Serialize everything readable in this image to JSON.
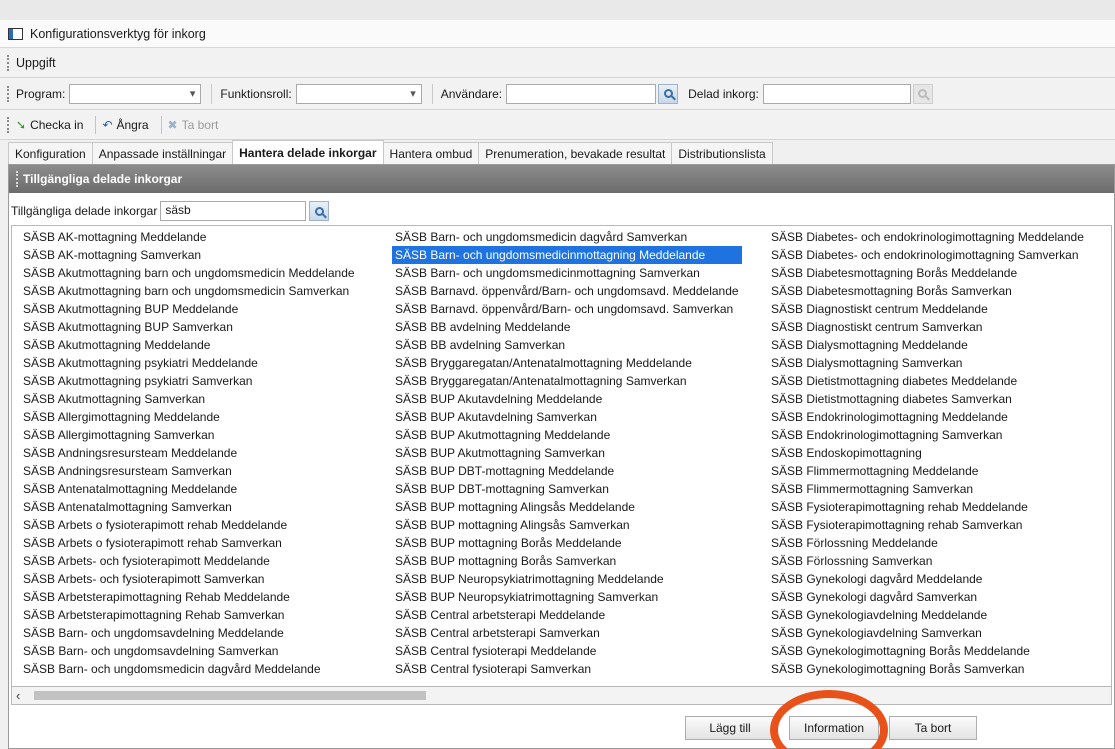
{
  "window": {
    "title": "Konfigurationsverktyg för inkorg"
  },
  "menu": {
    "item": "Uppgift"
  },
  "filters": {
    "program_label": "Program:",
    "funktionsroll_label": "Funktionsroll:",
    "anvandare_label": "Användare:",
    "delad_inkorg_label": "Delad inkorg:"
  },
  "toolbar": {
    "checkin_label": "Checka in",
    "undo_label": "Ångra",
    "remove_label": "Ta bort"
  },
  "tabs": [
    {
      "label": "Konfiguration"
    },
    {
      "label": "Anpassade inställningar"
    },
    {
      "label": "Hantera delade inkorgar",
      "active": true
    },
    {
      "label": "Hantera ombud"
    },
    {
      "label": "Prenumeration, bevakade resultat"
    },
    {
      "label": "Distributionslista"
    }
  ],
  "panel": {
    "header": "Tillgängliga delade inkorgar",
    "search_label": "Tillgängliga delade inkorgar",
    "search_value": "säsb"
  },
  "list": {
    "selected": "SÄSB Barn- och ungdomsmedicinmottagning Meddelande",
    "col1": [
      "SÄSB AK-mottagning Meddelande",
      "SÄSB AK-mottagning Samverkan",
      "SÄSB Akutmottagning barn och ungdomsmedicin Meddelande",
      "SÄSB Akutmottagning barn och ungdomsmedicin Samverkan",
      "SÄSB Akutmottagning BUP Meddelande",
      "SÄSB Akutmottagning BUP Samverkan",
      "SÄSB Akutmottagning Meddelande",
      "SÄSB Akutmottagning psykiatri Meddelande",
      "SÄSB Akutmottagning psykiatri Samverkan",
      "SÄSB Akutmottagning Samverkan",
      "SÄSB Allergimottagning Meddelande",
      "SÄSB Allergimottagning Samverkan",
      "SÄSB Andningsresursteam Meddelande",
      "SÄSB Andningsresursteam Samverkan",
      "SÄSB Antenatalmottagning Meddelande",
      "SÄSB Antenatalmottagning Samverkan",
      "SÄSB Arbets o fysioterapimott rehab Meddelande",
      "SÄSB Arbets o fysioterapimott rehab Samverkan",
      "SÄSB Arbets- och fysioterapimott Meddelande",
      "SÄSB Arbets- och fysioterapimott Samverkan",
      "SÄSB Arbetsterapimottagning Rehab Meddelande",
      "SÄSB Arbetsterapimottagning Rehab Samverkan",
      "SÄSB Barn- och ungdomsavdelning Meddelande",
      "SÄSB Barn- och ungdomsavdelning Samverkan",
      "SÄSB Barn- och ungdomsmedicin dagvård Meddelande"
    ],
    "col2": [
      "SÄSB Barn- och ungdomsmedicin dagvård Samverkan",
      "SÄSB Barn- och ungdomsmedicinmottagning Meddelande",
      "SÄSB Barn- och ungdomsmedicinmottagning Samverkan",
      "SÄSB Barnavd. öppenvård/Barn- och ungdomsavd. Meddelande",
      "SÄSB Barnavd. öppenvård/Barn- och ungdomsavd. Samverkan",
      "SÄSB BB avdelning Meddelande",
      "SÄSB BB avdelning Samverkan",
      "SÄSB Bryggaregatan/Antenatalmottagning Meddelande",
      "SÄSB Bryggaregatan/Antenatalmottagning Samverkan",
      "SÄSB BUP Akutavdelning Meddelande",
      "SÄSB BUP Akutavdelning Samverkan",
      "SÄSB BUP Akutmottagning Meddelande",
      "SÄSB BUP Akutmottagning Samverkan",
      "SÄSB BUP DBT-mottagning Meddelande",
      "SÄSB BUP DBT-mottagning Samverkan",
      "SÄSB BUP mottagning Alingsås Meddelande",
      "SÄSB BUP mottagning Alingsås Samverkan",
      "SÄSB BUP mottagning Borås Meddelande",
      "SÄSB BUP mottagning Borås Samverkan",
      "SÄSB BUP Neuropsykiatrimottagning Meddelande",
      "SÄSB BUP Neuropsykiatrimottagning Samverkan",
      "SÄSB Central arbetsterapi Meddelande",
      "SÄSB Central arbetsterapi Samverkan",
      "SÄSB Central fysioterapi Meddelande",
      "SÄSB Central fysioterapi Samverkan"
    ],
    "col3": [
      "SÄSB Diabetes- och endokrinologimottagning Meddelande",
      "SÄSB Diabetes- och endokrinologimottagning Samverkan",
      "SÄSB Diabetesmottagning Borås Meddelande",
      "SÄSB Diabetesmottagning Borås Samverkan",
      "SÄSB Diagnostiskt centrum Meddelande",
      "SÄSB Diagnostiskt centrum Samverkan",
      "SÄSB Dialysmottagning Meddelande",
      "SÄSB Dialysmottagning Samverkan",
      "SÄSB Dietistmottagning diabetes Meddelande",
      "SÄSB Dietistmottagning diabetes Samverkan",
      "SÄSB Endokrinologimottagning Meddelande",
      "SÄSB Endokrinologimottagning Samverkan",
      "SÄSB Endoskopimottagning",
      "SÄSB Flimmermottagning Meddelande",
      "SÄSB Flimmermottagning Samverkan",
      "SÄSB Fysioterapimottagning rehab Meddelande",
      "SÄSB Fysioterapimottagning rehab Samverkan",
      "SÄSB Förlossning Meddelande",
      "SÄSB Förlossning Samverkan",
      "SÄSB Gynekologi dagvård Meddelande",
      "SÄSB Gynekologi dagvård Samverkan",
      "SÄSB Gynekologiavdelning Meddelande",
      "SÄSB Gynekologiavdelning Samverkan",
      "SÄSB Gynekologimottagning Borås Meddelande",
      "SÄSB Gynekologimottagning Borås Samverkan"
    ]
  },
  "buttons": {
    "add_label": "Lägg till",
    "info_label": "Information",
    "remove_label": "Ta bort"
  },
  "colors": {
    "selection": "#1e73e0",
    "annotation_ring": "#e8521a",
    "panel_header": "#7a7a7a"
  }
}
